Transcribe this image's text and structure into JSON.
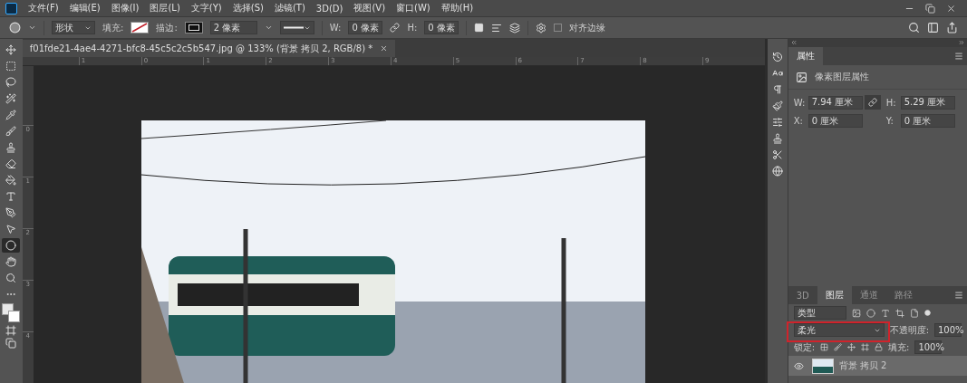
{
  "menu_bar": {
    "items": [
      "文件(F)",
      "编辑(E)",
      "图像(I)",
      "图层(L)",
      "文字(Y)",
      "选择(S)",
      "滤镜(T)",
      "3D(D)",
      "视图(V)",
      "窗口(W)",
      "帮助(H)"
    ]
  },
  "options_bar": {
    "mode": "形状",
    "fill_label": "填充:",
    "stroke_label": "描边:",
    "stroke_width": "2 像素",
    "w_label": "W:",
    "w_value": "0 像素",
    "h_label": "H:",
    "h_value": "0 像素",
    "align_edges": {
      "label": "对齐边缘",
      "checked": false
    }
  },
  "document_tab": {
    "title": "f01fde21-4ae4-4271-bfc8-45c5c2c5b547.jpg @ 133% (背景 拷贝 2, RGB/8) *"
  },
  "rulers": {
    "horizontal": [
      "1",
      "0",
      "1",
      "2",
      "3",
      "4",
      "5",
      "6",
      "7",
      "8",
      "9"
    ],
    "vertical": [
      "0",
      "1",
      "2",
      "3",
      "4"
    ]
  },
  "tools": [
    {
      "kind": "move",
      "selected": false
    },
    {
      "kind": "marquee",
      "selected": false
    },
    {
      "kind": "lasso",
      "selected": false
    },
    {
      "kind": "quick-select",
      "selected": false
    },
    {
      "kind": "eyedropper",
      "selected": false
    },
    {
      "kind": "brush",
      "selected": false
    },
    {
      "kind": "stamp",
      "selected": false
    },
    {
      "kind": "eraser",
      "selected": false
    },
    {
      "kind": "bucket",
      "selected": false
    },
    {
      "kind": "type",
      "selected": false
    },
    {
      "kind": "pen",
      "selected": false
    },
    {
      "kind": "pointer",
      "selected": false
    },
    {
      "kind": "ellipse",
      "selected": true
    },
    {
      "kind": "hand",
      "selected": false
    },
    {
      "kind": "zoom",
      "selected": false
    },
    {
      "kind": "more",
      "selected": false
    }
  ],
  "properties_panel": {
    "tab": "属性",
    "header": "像素图层属性",
    "fields": [
      {
        "label": "W:",
        "value": "7.94 厘米"
      },
      {
        "label": "H:",
        "value": "5.29 厘米"
      },
      {
        "label": "X:",
        "value": "0 厘米"
      },
      {
        "label": "Y:",
        "value": "0 厘米"
      }
    ]
  },
  "layers_panel": {
    "tabs": [
      {
        "label": "3D",
        "selected": false
      },
      {
        "label": "图层",
        "selected": true
      },
      {
        "label": "通道",
        "selected": false
      },
      {
        "label": "路径",
        "selected": false
      }
    ],
    "filter": "类型",
    "blend_mode": "柔光",
    "opacity_label": "不透明度:",
    "opacity": "100%",
    "lock_label": "锁定:",
    "fill_label": "填充:",
    "fill": "100%",
    "layers": [
      {
        "name": "背景 拷贝 2",
        "visible": true,
        "selected": true
      }
    ]
  }
}
